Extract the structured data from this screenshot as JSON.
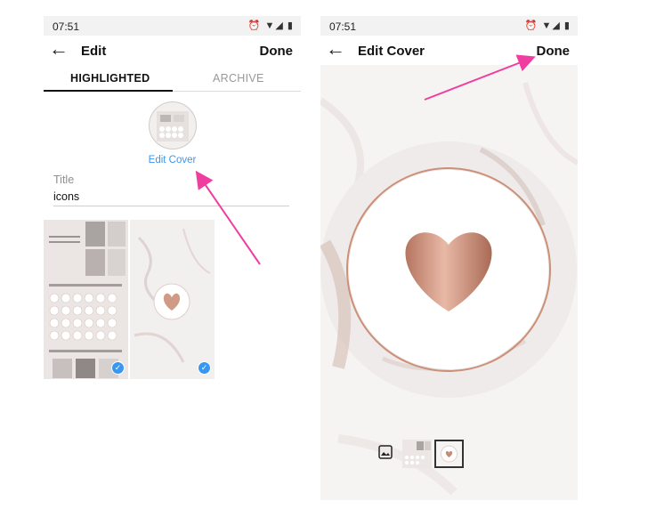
{
  "left": {
    "status": {
      "time": "07:51",
      "icons": "⏰ ▼◢ ▮"
    },
    "header": {
      "title": "Edit",
      "done_label": "Done"
    },
    "tabs": [
      {
        "label": "HIGHLIGHTED"
      },
      {
        "label": "ARCHIVE"
      }
    ],
    "edit_cover_label": "Edit Cover",
    "title_label": "Title",
    "title_value": "icons"
  },
  "right": {
    "status": {
      "time": "07:51",
      "icons": "⏰ ▼◢ ▮"
    },
    "header": {
      "title": "Edit Cover",
      "done_label": "Done"
    }
  },
  "colors": {
    "accent_blue": "#3897f0",
    "annotation_arrow": "#f03ea0",
    "rose_gold": "#c98b73"
  },
  "icons": {
    "back": "back-arrow-icon",
    "gallery": "image-icon",
    "check": "check-icon"
  }
}
